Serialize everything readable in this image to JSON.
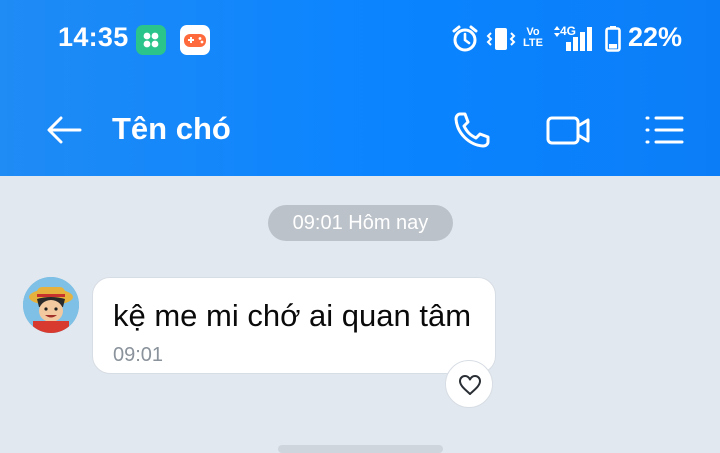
{
  "status_bar": {
    "time": "14:35",
    "network_label": "4G",
    "volte_label": "Vo LTE",
    "battery_percent": "22%",
    "icons": [
      "green-app-icon",
      "game-app-icon",
      "alarm-icon",
      "vibrate-icon",
      "volte-icon",
      "signal-icon",
      "battery-icon"
    ]
  },
  "header": {
    "title": "Tên chó",
    "back_icon": "arrow-left-icon",
    "actions": [
      {
        "name": "call",
        "icon": "phone-icon"
      },
      {
        "name": "video",
        "icon": "video-icon"
      },
      {
        "name": "menu",
        "icon": "list-icon"
      }
    ]
  },
  "chat": {
    "date_separator": "09:01 Hôm nay",
    "messages": [
      {
        "text": "kệ me mi chớ ai quan tâm",
        "time": "09:01",
        "reaction_icon": "heart-outline-icon"
      }
    ]
  },
  "colors": {
    "header_blue": "#0a84ff",
    "chat_background": "#e2e8ef",
    "bubble_white": "#ffffff",
    "time_pill_gray": "#bcc2c9"
  }
}
